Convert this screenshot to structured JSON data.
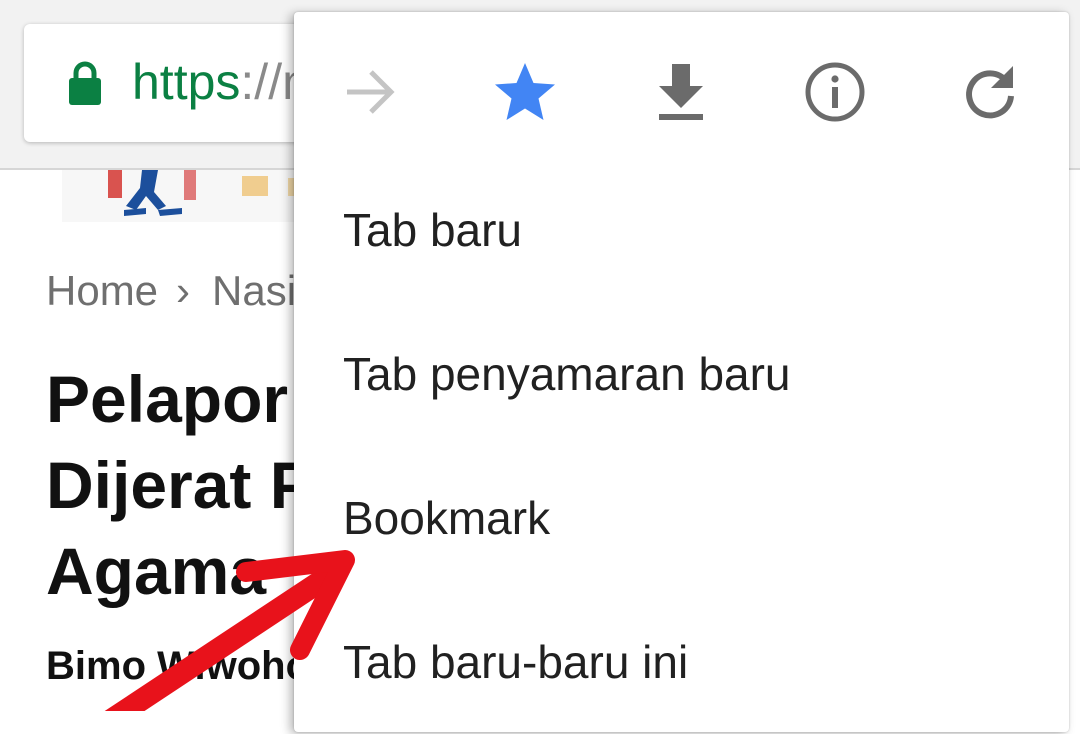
{
  "browser": {
    "url_scheme": "https",
    "url_rest": "://m"
  },
  "page": {
    "breadcrumb": {
      "home": "Home",
      "separator": "›",
      "section": "Nasional"
    },
    "article": {
      "title": "Pelapor\nDijerat Pasal\nAgama",
      "author": "Bimo Wiwoho"
    }
  },
  "menu": {
    "icons": [
      {
        "name": "forward-icon",
        "enabled": false
      },
      {
        "name": "bookmark-star-icon",
        "active": true
      },
      {
        "name": "download-icon"
      },
      {
        "name": "page-info-icon"
      },
      {
        "name": "reload-icon"
      }
    ],
    "items": [
      {
        "label": "Tab baru"
      },
      {
        "label": "Tab penyamaran baru"
      },
      {
        "label": "Bookmark"
      },
      {
        "label": "Tab baru-baru ini"
      }
    ]
  },
  "colors": {
    "secure": "#0b8043",
    "star_active": "#4285f4",
    "icon_default": "#6b6b6b",
    "icon_disabled": "#c4c4c4",
    "annotation_arrow": "#e8121b"
  }
}
